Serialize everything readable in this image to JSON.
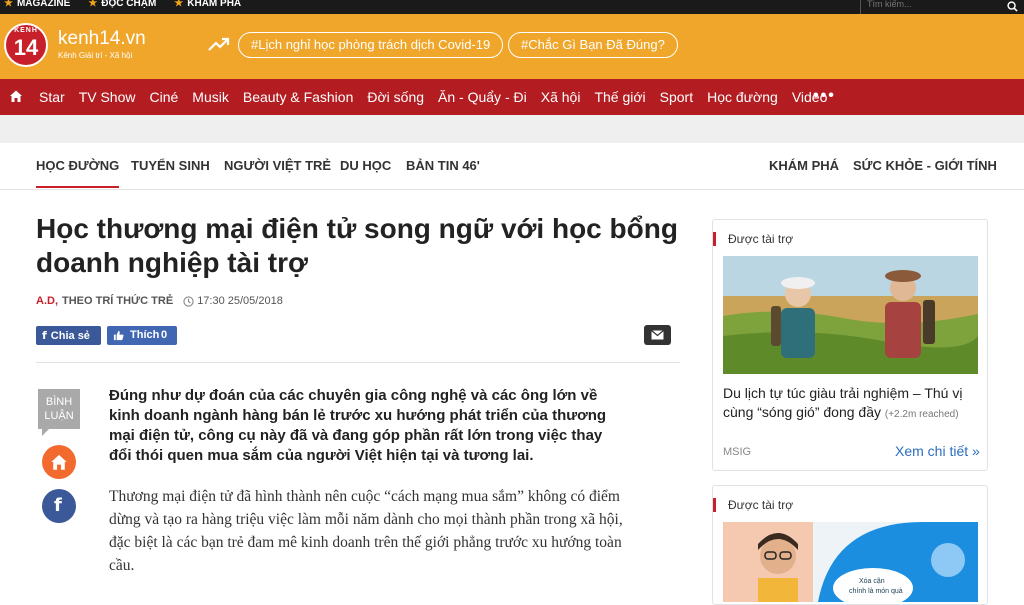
{
  "topbar": {
    "links": [
      "MAGAZINE",
      "ĐỌC CHẬM",
      "KHÁM PHÁ"
    ],
    "search_placeholder": "Tìm kiếm..."
  },
  "header": {
    "logo_top": "KENH",
    "logo_number": "14",
    "site_name": "kenh14.vn",
    "site_tagline": "Kênh Giải trí - Xã hội",
    "trends": [
      "#Lịch nghỉ học phòng trách dịch Covid-19",
      "#Chắc Gì Bạn Đã Đúng?"
    ]
  },
  "nav": {
    "items": [
      "Star",
      "TV Show",
      "Ciné",
      "Musik",
      "Beauty & Fashion",
      "Đời sống",
      "Ăn - Quẩy - Đi",
      "Xã hội",
      "Thế giới",
      "Sport",
      "Học đường",
      "Video"
    ],
    "more": "•••"
  },
  "subnav": {
    "left": [
      "HỌC ĐƯỜNG",
      "TUYỂN SINH",
      "NGƯỜI VIỆT TRẺ",
      "DU HỌC",
      "BẢN TIN 46'"
    ],
    "right": [
      "KHÁM PHÁ",
      "SỨC KHỎE - GIỚI TÍNH"
    ]
  },
  "article": {
    "title": "Học thương mại điện tử song ngữ với học bổng doanh nghiệp tài trợ",
    "author": "A.D,",
    "source": "THEO TRÍ THỨC TRẺ",
    "time": "17:30 25/05/2018",
    "share_label": "Chia sẻ",
    "like_label": "Thích",
    "like_count": "0",
    "comment_label_1": "BÌNH",
    "comment_label_2": "LUẬN",
    "lead": "Đúng như dự đoán của các chuyên gia công nghệ và các ông lớn về kinh doanh ngành hàng bán lẻ trước xu hướng phát triển của thương mại điện tử, công cụ này đã và đang góp phần rất lớn trong việc thay đổi thói quen mua sắm của người Việt hiện tại và tương lai.",
    "body": "Thương mại điện tử đã hình thành nên cuộc “cách mạng mua sắm” không có điểm dừng và tạo ra hàng triệu việc làm mỗi năm dành cho mọi thành phần trong xã hội, đặc biệt là các bạn trẻ đam mê kinh doanh trên thế giới phẳng trước xu hướng toàn cầu."
  },
  "sidebar": {
    "cards": [
      {
        "header": "Được tài trợ",
        "title": "Du lịch tự túc giàu trải nghiệm – Thú vị cùng “sóng gió” đong đầy",
        "reach": "(+2.2m reached)",
        "brand": "MSIG",
        "more": "Xem chi tiết »"
      },
      {
        "header": "Được tài trợ",
        "image_text_1": "Xóa cận",
        "image_text_2": "chính là món quà"
      }
    ]
  },
  "colors": {
    "header_orange": "#f0a62a",
    "nav_red": "#b31d22",
    "accent_red": "#c8202a",
    "facebook_blue": "#3b5998",
    "link_blue": "#2c6ebf"
  }
}
